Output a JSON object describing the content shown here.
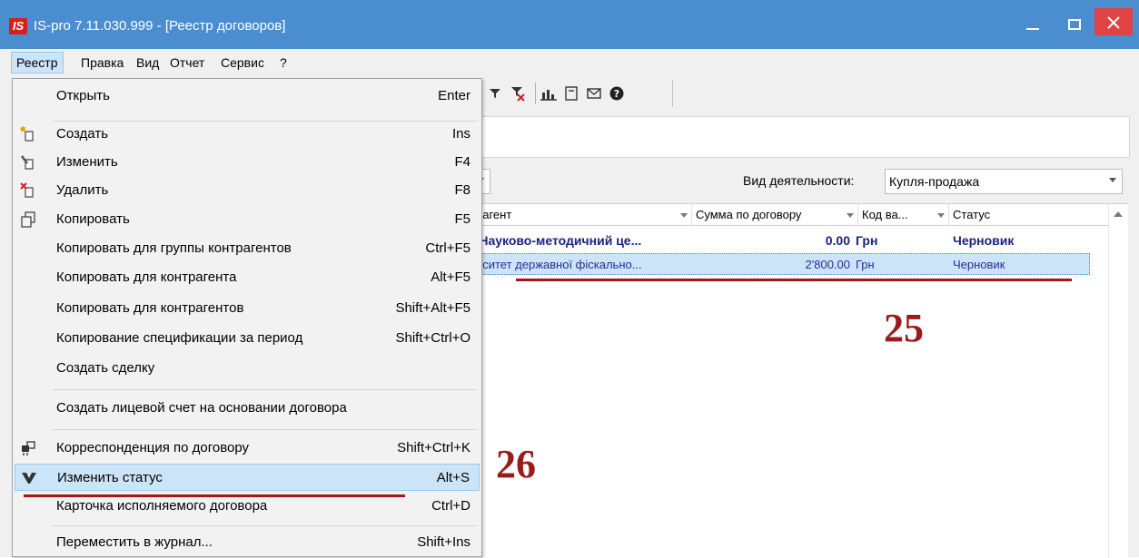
{
  "window": {
    "logo": "IS",
    "title": "IS-pro 7.11.030.999 - [Реестр договоров]"
  },
  "menubar": [
    "Реестр",
    "Правка",
    "Вид",
    "Отчет",
    "Сервис",
    "?"
  ],
  "dropdown": {
    "items": [
      {
        "label": "Открыть",
        "shortcut": "Enter",
        "icon": ""
      },
      {
        "label": "Создать",
        "shortcut": "Ins",
        "icon": "create-doc-icon"
      },
      {
        "label": "Изменить",
        "shortcut": "F4",
        "icon": "edit-doc-icon"
      },
      {
        "label": "Удалить",
        "shortcut": "F8",
        "icon": "delete-doc-icon"
      },
      {
        "label": "Копировать",
        "shortcut": "F5",
        "icon": "copy-icon"
      },
      {
        "label": "Копировать для группы контрагентов",
        "shortcut": "Ctrl+F5",
        "icon": ""
      },
      {
        "label": "Копировать для контрагента",
        "shortcut": "Alt+F5",
        "icon": ""
      },
      {
        "label": "Копировать для контрагентов",
        "shortcut": "Shift+Alt+F5",
        "icon": ""
      },
      {
        "label": "Копирование спецификации за период",
        "shortcut": "Shift+Ctrl+O",
        "icon": ""
      },
      {
        "label": "Создать сделку",
        "shortcut": "",
        "icon": ""
      },
      {
        "label": "Создать лицевой счет на основании договора",
        "shortcut": "",
        "icon": ""
      },
      {
        "label": "Корреспонденция по договору",
        "shortcut": "Shift+Ctrl+K",
        "icon": "correspondence-icon"
      },
      {
        "label": "Изменить статус",
        "shortcut": "Alt+S",
        "icon": "change-status-icon"
      },
      {
        "label": "Карточка исполняемого договора",
        "shortcut": "Ctrl+D",
        "icon": ""
      },
      {
        "label": "Переместить в журнал...",
        "shortcut": "Shift+Ins",
        "icon": ""
      }
    ]
  },
  "filter": {
    "vid_label": "Вид деятельности:",
    "vid_value": "Купля-продажа"
  },
  "grid": {
    "columns": [
      "рагент",
      "Сумма по договору",
      "Код ва...",
      "Статус"
    ],
    "rows": [
      {
        "agent": "'Науково-методичний це...",
        "sum": "0.00",
        "currency": "Грн",
        "status": "Черновик"
      },
      {
        "agent": "рситет державної фіскально...",
        "sum": "2'800.00",
        "currency": "Грн",
        "status": "Черновик"
      }
    ]
  },
  "annotations": {
    "a25": "25",
    "a26": "26"
  },
  "colors": {
    "titlebar": "#4a8ed0",
    "close": "#e04343",
    "annotation": "#9b1b1b",
    "highlight": "#cce4f7"
  }
}
